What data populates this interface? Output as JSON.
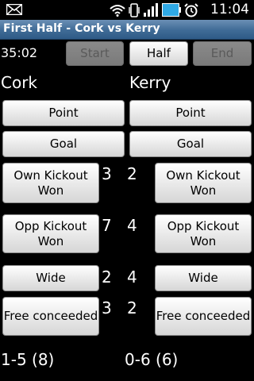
{
  "status": {
    "time": "11:04"
  },
  "title": "First Half - Cork vs Kerry",
  "timer": "35:02",
  "controls": {
    "start": "Start",
    "half": "Half",
    "end": "End"
  },
  "teams": {
    "home": {
      "name": "Cork",
      "point": "Point",
      "goal": "Goal",
      "own_kickout": "Own Kickout Won",
      "opp_kickout": "Opp Kickout Won",
      "wide": "Wide",
      "free": "Free conceeded",
      "counts": {
        "own_kickout": "3",
        "opp_kickout": "7",
        "wide": "2",
        "free": "3"
      },
      "score": "1-5 (8)"
    },
    "away": {
      "name": "Kerry",
      "point": "Point",
      "goal": "Goal",
      "own_kickout": "Own Kickout Won",
      "opp_kickout": "Opp Kickout Won",
      "wide": "Wide",
      "free": "Free conceeded",
      "counts": {
        "own_kickout": "2",
        "opp_kickout": "4",
        "wide": "4",
        "free": "2"
      },
      "score": "0-6 (6)"
    }
  }
}
